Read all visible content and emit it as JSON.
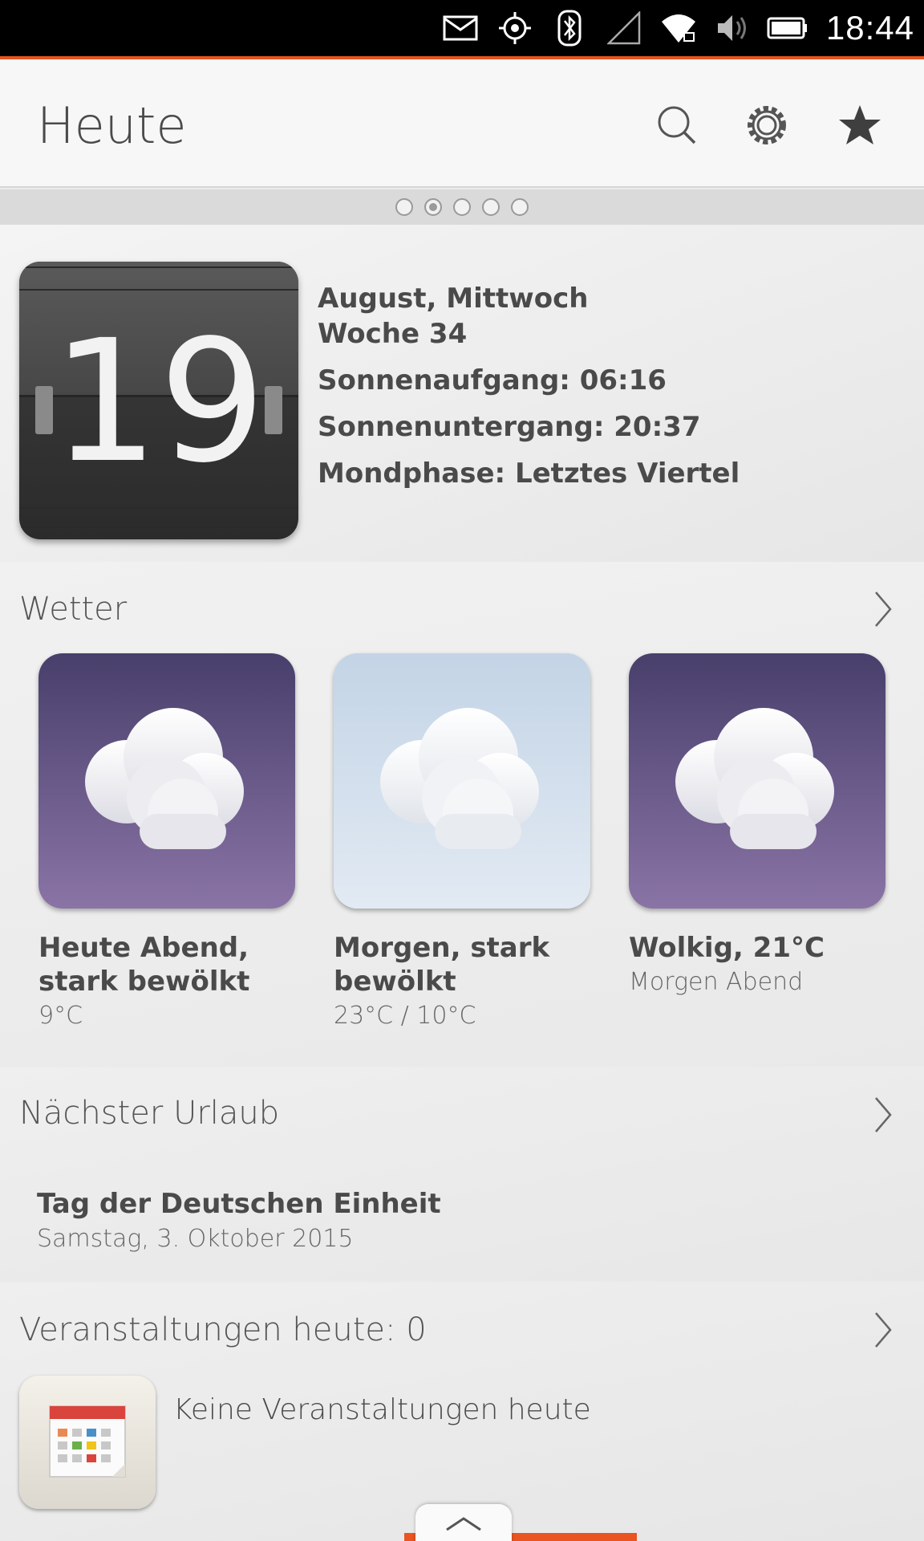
{
  "status_bar": {
    "time": "18:44",
    "icons": [
      "mail-icon",
      "location-icon",
      "bluetooth-icon",
      "signal-icon",
      "wifi-icon",
      "volume-icon",
      "battery-icon"
    ]
  },
  "header": {
    "title": "Heute",
    "actions": [
      "search-icon",
      "settings-icon",
      "favorite-star-icon"
    ]
  },
  "pager": {
    "count": 5,
    "active_index": 1
  },
  "date_card": {
    "day": "19",
    "month_weekday": "August, Mittwoch",
    "week": "Woche 34",
    "sunrise": "Sonnenaufgang: 06:16",
    "sunset": "Sonnenuntergang: 20:37",
    "moon_phase": "Mondphase: Letztes Viertel"
  },
  "weather": {
    "title": "Wetter",
    "items": [
      {
        "title": "Heute Abend, stark bewölkt",
        "subtitle": "9°C",
        "icon": "cloudy-icon",
        "tile": "purple"
      },
      {
        "title": "Morgen, stark bewölkt",
        "subtitle": "23°C / 10°C",
        "icon": "cloudy-icon",
        "tile": "light"
      },
      {
        "title": "Wolkig, 21°C",
        "subtitle": "Morgen Abend",
        "icon": "cloudy-icon",
        "tile": "purple"
      }
    ]
  },
  "holiday": {
    "title": "Nächster Urlaub",
    "name": "Tag der Deutschen Einheit",
    "date": "Samstag, 3. Oktober 2015"
  },
  "events": {
    "title": "Veranstaltungen heute: 0",
    "empty_text": "Keine Veranstaltungen heute",
    "icon": "calendar-icon"
  },
  "colors": {
    "accent": "#e95420",
    "tile_purple_top": "#483f6b",
    "tile_purple_bottom": "#8a74a6",
    "tile_light": "#c3d4e6"
  }
}
